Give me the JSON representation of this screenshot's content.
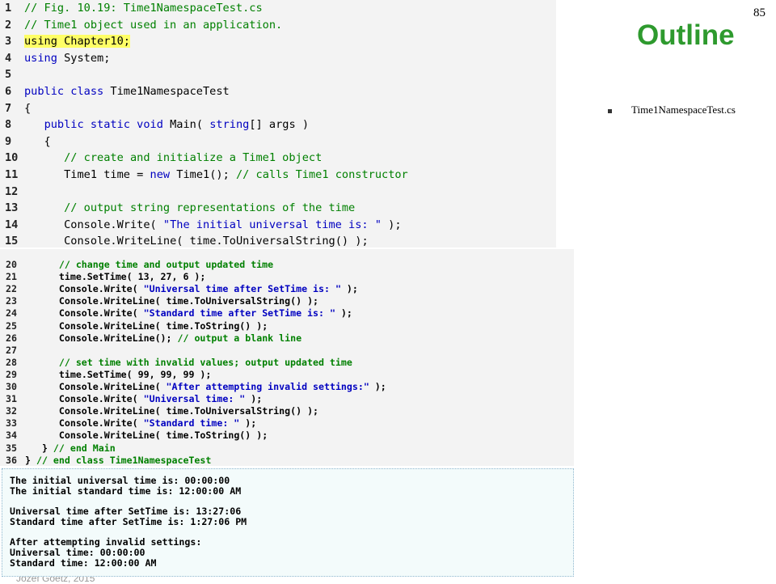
{
  "slide": {
    "page_number": "85",
    "outline_title": "Outline",
    "outline_item": "Time1NamespaceTest.cs",
    "footer": "Jozef Goetz, 2015"
  },
  "code_top": [
    {
      "n": "1",
      "s": "// Fig. 10.19: Time1NamespaceTest.cs",
      "t": "c"
    },
    {
      "n": "2",
      "s": "// Time1 object used in an application.",
      "t": "c"
    },
    {
      "n": "3",
      "s": "using Chapter10;",
      "t": "hl"
    },
    {
      "n": "4",
      "s": "using System;",
      "t": "p"
    },
    {
      "n": "5",
      "s": "",
      "t": "p"
    },
    {
      "n": "6",
      "s": "public class Time1NamespaceTest",
      "t": "p"
    },
    {
      "n": "7",
      "s": "{",
      "t": "p"
    },
    {
      "n": "8",
      "s": "   public static void Main( string[] args )",
      "t": "p"
    },
    {
      "n": "9",
      "s": "   {",
      "t": "p"
    },
    {
      "n": "10",
      "s": "      // create and initialize a Time1 object",
      "t": "c"
    },
    {
      "n": "11",
      "s": "      Time1 time = new Time1(); // calls Time1 constructor",
      "t": "p"
    },
    {
      "n": "12",
      "s": "",
      "t": "p"
    },
    {
      "n": "13",
      "s": "      // output string representations of the time",
      "t": "c"
    },
    {
      "n": "14",
      "s": "      Console.Write( \"The initial universal time is: \" );",
      "t": "p"
    },
    {
      "n": "15",
      "s": "      Console.WriteLine( time.ToUniversalString() );",
      "t": "p"
    }
  ],
  "code_bottom": [
    {
      "n": "20",
      "s": "      // change time and output updated time",
      "t": "c"
    },
    {
      "n": "21",
      "s": "      time.SetTime( 13, 27, 6 );",
      "t": "p"
    },
    {
      "n": "22",
      "s": "      Console.Write( \"Universal time after SetTime is: \" );",
      "t": "p"
    },
    {
      "n": "23",
      "s": "      Console.WriteLine( time.ToUniversalString() );",
      "t": "p"
    },
    {
      "n": "24",
      "s": "      Console.Write( \"Standard time after SetTime is: \" );",
      "t": "p"
    },
    {
      "n": "25",
      "s": "      Console.WriteLine( time.ToString() );",
      "t": "p"
    },
    {
      "n": "26",
      "s": "      Console.WriteLine(); // output a blank line",
      "t": "p"
    },
    {
      "n": "27",
      "s": "",
      "t": "p"
    },
    {
      "n": "28",
      "s": "      // set time with invalid values; output updated time",
      "t": "c"
    },
    {
      "n": "29",
      "s": "      time.SetTime( 99, 99, 99 );",
      "t": "p"
    },
    {
      "n": "30",
      "s": "      Console.WriteLine( \"After attempting invalid settings:\" );",
      "t": "p"
    },
    {
      "n": "31",
      "s": "      Console.Write( \"Universal time: \" );",
      "t": "p"
    },
    {
      "n": "32",
      "s": "      Console.WriteLine( time.ToUniversalString() );",
      "t": "p"
    },
    {
      "n": "33",
      "s": "      Console.Write( \"Standard time: \" );",
      "t": "p"
    },
    {
      "n": "34",
      "s": "      Console.WriteLine( time.ToString() );",
      "t": "p"
    },
    {
      "n": "35",
      "s": "   } // end Main",
      "t": "p"
    },
    {
      "n": "36",
      "s": "} // end class Time1NamespaceTest",
      "t": "p"
    }
  ],
  "output_lines": [
    "The initial universal time is: 00:00:00",
    "The initial standard time is: 12:00:00 AM",
    "",
    "Universal time after SetTime is: 13:27:06",
    "Standard time after SetTime is: 1:27:06 PM",
    "",
    "After attempting invalid settings:",
    "Universal time: 00:00:00",
    "Standard time: 12:00:00 AM"
  ],
  "colors": {
    "comment": "#008000",
    "keyword": "#0000c0",
    "string": "#0000c0",
    "highlight": "#ffff66",
    "outline": "#2e9a2e"
  }
}
